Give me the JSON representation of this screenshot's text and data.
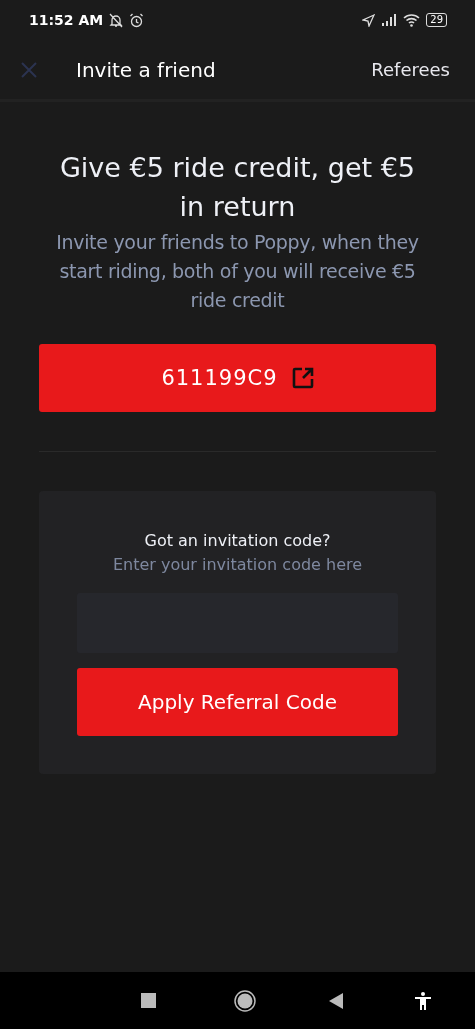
{
  "status_bar": {
    "time": "11:52 AM",
    "battery": "29"
  },
  "header": {
    "title": "Invite a friend",
    "action": "Referees"
  },
  "headline": "Give €5 ride credit, get €5 in return",
  "description": "Invite your friends to Poppy, when they start riding, both of you will receive €5 ride credit",
  "referral_code": "611199C9",
  "invitation": {
    "title": "Got an invitation code?",
    "subtitle": "Enter your invitation code here",
    "button": "Apply Referral Code"
  }
}
